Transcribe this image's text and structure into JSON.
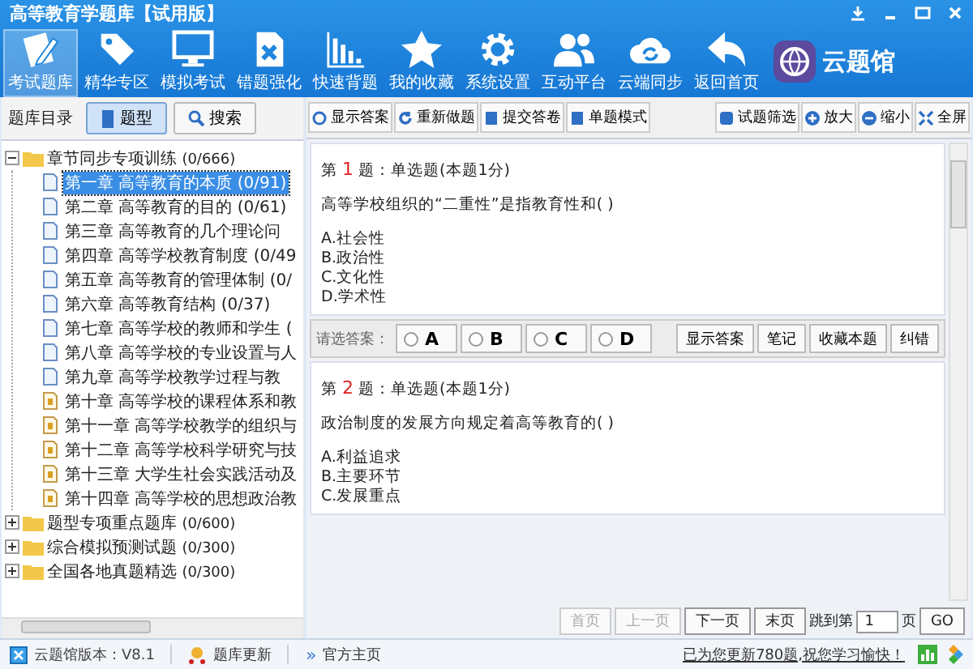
{
  "window": {
    "title": "高等教育学题库【试用版】"
  },
  "toolbar": [
    {
      "label": "考试题库",
      "selected": true
    },
    {
      "label": "精华专区",
      "selected": false
    },
    {
      "label": "模拟考试",
      "selected": false
    },
    {
      "label": "错题强化",
      "selected": false
    },
    {
      "label": "快速背题",
      "selected": false
    },
    {
      "label": "我的收藏",
      "selected": false
    },
    {
      "label": "系统设置",
      "selected": false
    },
    {
      "label": "互动平台",
      "selected": false
    },
    {
      "label": "云端同步",
      "selected": false
    },
    {
      "label": "返回首页",
      "selected": false
    }
  ],
  "brand": "云题馆",
  "sidebar": {
    "title": "题库目录",
    "tabs": [
      {
        "label": "题型",
        "selected": true
      },
      {
        "label": "搜索",
        "selected": false
      }
    ],
    "tree": [
      {
        "label": "章节同步专项训练",
        "count": "(0/666)",
        "expanded": true,
        "children": [
          {
            "label": "第一章  高等教育的本质",
            "count": "(0/91)",
            "selected": true,
            "kind": "doc"
          },
          {
            "label": "第二章  高等教育的目的",
            "count": "(0/61)",
            "selected": false,
            "kind": "doc"
          },
          {
            "label": "第三章  高等教育的几个理论问",
            "selected": false,
            "kind": "doc"
          },
          {
            "label": "第四章  高等学校教育制度",
            "count": "(0/49",
            "selected": false,
            "kind": "doc"
          },
          {
            "label": "第五章  高等教育的管理体制",
            "count": "(0/",
            "selected": false,
            "kind": "doc"
          },
          {
            "label": "第六章  高等教育结构",
            "count": "(0/37)",
            "selected": false,
            "kind": "doc"
          },
          {
            "label": "第七章  高等学校的教师和学生",
            "count": "(",
            "selected": false,
            "kind": "doc"
          },
          {
            "label": "第八章  高等学校的专业设置与人",
            "selected": false,
            "kind": "doc"
          },
          {
            "label": "第九章  高等学校教学过程与教",
            "selected": false,
            "kind": "doc"
          },
          {
            "label": "第十章  高等学校的课程体系和教",
            "selected": false,
            "kind": "locked"
          },
          {
            "label": "第十一章  高等学校教学的组织与",
            "selected": false,
            "kind": "locked"
          },
          {
            "label": "第十二章  高等学校科学研究与技",
            "selected": false,
            "kind": "locked"
          },
          {
            "label": "第十三章  大学生社会实践活动及",
            "selected": false,
            "kind": "locked"
          },
          {
            "label": "第十四章  高等学校的思想政治教",
            "selected": false,
            "kind": "locked"
          }
        ]
      },
      {
        "label": "题型专项重点题库",
        "count": "(0/600)",
        "expanded": false
      },
      {
        "label": "综合模拟预测试题",
        "count": "(0/300)",
        "expanded": false
      },
      {
        "label": "全国各地真题精选",
        "count": "(0/300)",
        "expanded": false
      }
    ]
  },
  "question_toolbar": {
    "left": [
      "显示答案",
      "重新做题",
      "提交答卷",
      "单题模式"
    ],
    "right": [
      "试题筛选",
      "放大",
      "缩小",
      "全屏"
    ]
  },
  "questions": [
    {
      "prefix": "第",
      "number": "1",
      "suffix": "题：单选题(本题1分)",
      "text": "高等学校组织的“二重性”是指教育性和( )",
      "options": [
        "A.社会性",
        "B.政治性",
        "C.文化性",
        "D.学术性"
      ]
    },
    {
      "prefix": "第",
      "number": "2",
      "suffix": "题：单选题(本题1分)",
      "text": "政治制度的发展方向规定着高等教育的( )",
      "options": [
        "A.利益追求",
        "B.主要环节",
        "C.发展重点"
      ]
    }
  ],
  "answer_bar": {
    "label": "请选答案：",
    "choices": [
      {
        "label": "A",
        "selected": false
      },
      {
        "label": "B",
        "selected": false
      },
      {
        "label": "C",
        "selected": false
      },
      {
        "label": "D",
        "selected": false
      }
    ],
    "buttons": [
      "显示答案",
      "笔记",
      "收藏本题",
      "纠错"
    ]
  },
  "pagination": {
    "buttons": [
      {
        "label": "首页",
        "disabled": true
      },
      {
        "label": "上一页",
        "disabled": true
      },
      {
        "label": "下一页",
        "disabled": false
      },
      {
        "label": "末页",
        "disabled": false
      }
    ],
    "jump_label": "跳到第",
    "page": "1",
    "jump_suffix": "页",
    "go": "GO"
  },
  "status_bar": {
    "version": "云题馆版本：V8.1",
    "update": "题库更新",
    "home": "官方主页",
    "home_mark": "»",
    "notice": "已为您更新780题,祝您学习愉快！"
  }
}
